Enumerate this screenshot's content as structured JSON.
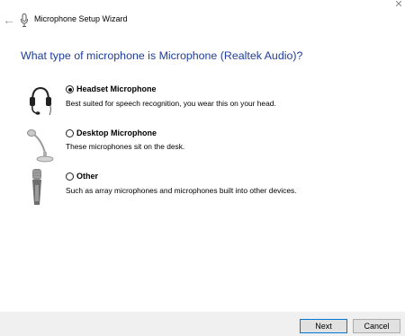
{
  "window": {
    "title": "Microphone Setup Wizard",
    "back_glyph": "←",
    "close_glyph": "✕"
  },
  "heading": "What type of microphone is Microphone (Realtek Audio)?",
  "options": [
    {
      "label": "Headset Microphone",
      "description": "Best suited for speech recognition, you wear this on your head.",
      "selected": true,
      "icon": "headset-icon"
    },
    {
      "label": "Desktop Microphone",
      "description": "These microphones sit on the desk.",
      "selected": false,
      "icon": "desktop-mic-icon"
    },
    {
      "label": "Other",
      "description": "Such as array microphones and microphones built into other devices.",
      "selected": false,
      "icon": "handheld-mic-icon"
    }
  ],
  "buttons": {
    "next": "Next",
    "cancel": "Cancel"
  },
  "colors": {
    "heading": "#1f3d99",
    "footer_bg": "#f0f0f0",
    "accent": "#0078d7"
  }
}
